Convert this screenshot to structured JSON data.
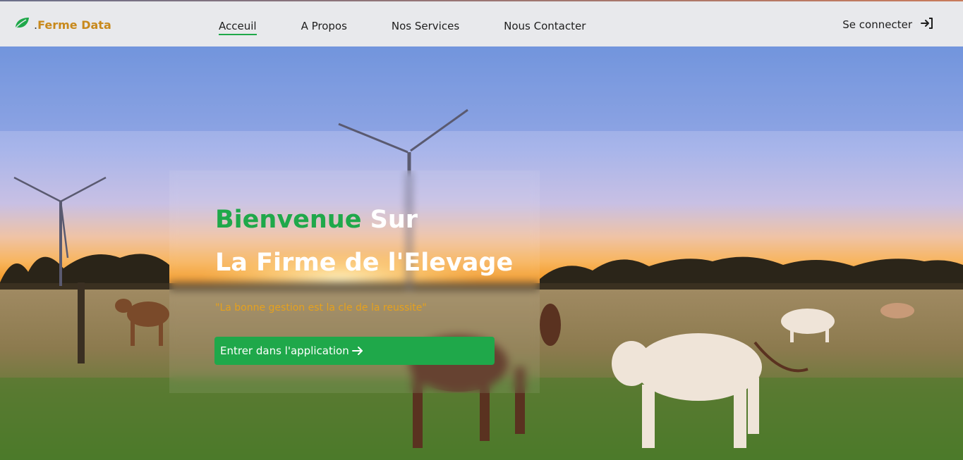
{
  "brand": {
    "prefix": ".",
    "name": "Ferme Data",
    "icon": "leaf-icon",
    "color": "#c8891c"
  },
  "nav": {
    "items": [
      {
        "label": "Acceuil",
        "active": true
      },
      {
        "label": "A Propos",
        "active": false
      },
      {
        "label": "Nos Services",
        "active": false
      },
      {
        "label": "Nous Contacter",
        "active": false
      }
    ],
    "accent": "#1fa84a"
  },
  "login": {
    "label": "Se connecter",
    "icon": "login-arrow-icon"
  },
  "hero": {
    "title_green": "Bienvenue",
    "title_white": " Sur",
    "subtitle": "La Firme de l'Elevage",
    "quote": "\"La bonne gestion est la cle de la reussite\"",
    "cta_label": "Entrer dans l'application",
    "cta_icon": "arrow-right-icon",
    "background": "farm-landscape-image"
  }
}
